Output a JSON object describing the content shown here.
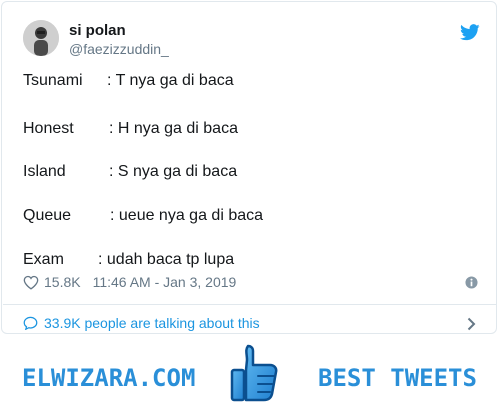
{
  "tweet": {
    "author_name": "si polan",
    "author_handle": "@faezizzuddin_",
    "lines": [
      {
        "label": "Tsunami",
        "value": ": T nya ga di baca"
      },
      {
        "label": "Honest",
        "value": ": H nya ga di baca"
      },
      {
        "label": "Island",
        "value": ": S nya ga di baca"
      },
      {
        "label": "Queue",
        "value": ": ueue nya ga di baca"
      },
      {
        "label": "Exam",
        "value": ": udah baca tp lupa"
      }
    ],
    "likes": "15.8K",
    "timestamp": "11:46 AM - Jan 3, 2019",
    "talking": "33.9K people are talking about this"
  },
  "footer": {
    "brand": "ELWIZARA.COM",
    "tagline": "BEST TWEETS"
  },
  "colors": {
    "link": "#1b95e0",
    "brand": "#2a8fd8",
    "twitter": "#1da1f2",
    "muted": "#657786"
  },
  "icons": [
    "twitter-bird-icon",
    "heart-icon",
    "info-icon",
    "speech-bubble-icon",
    "chevron-right-icon",
    "thumbs-up-icon"
  ]
}
